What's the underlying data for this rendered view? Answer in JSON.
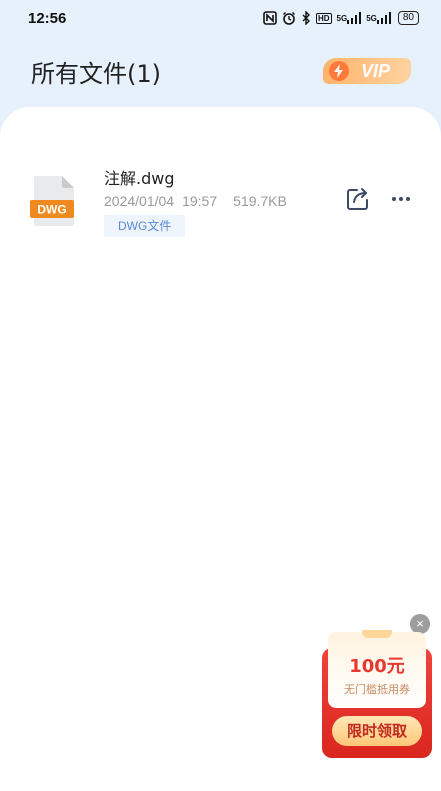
{
  "status_bar": {
    "time": "12:56",
    "network_5g_1": "5G",
    "network_5g_2": "5G",
    "hd_label": "HD",
    "battery": "80"
  },
  "header": {
    "title": "所有文件(1)",
    "vip_label": "VIP"
  },
  "files": [
    {
      "icon_label": "DWG",
      "name": "注解.dwg",
      "date": "2024/01/04",
      "time": "19:57",
      "size": "519.7KB",
      "tag": "DWG文件"
    }
  ],
  "promo": {
    "close": "×",
    "amount": "100元",
    "description": "无门槛抵用券",
    "button": "限时领取"
  },
  "colors": {
    "header_bg": "#e6f1fb",
    "file_icon_accent": "#f08a1e",
    "tag_text": "#5b8bd2",
    "promo_red": "#e8372f",
    "vip_orange": "#ffb36b"
  }
}
